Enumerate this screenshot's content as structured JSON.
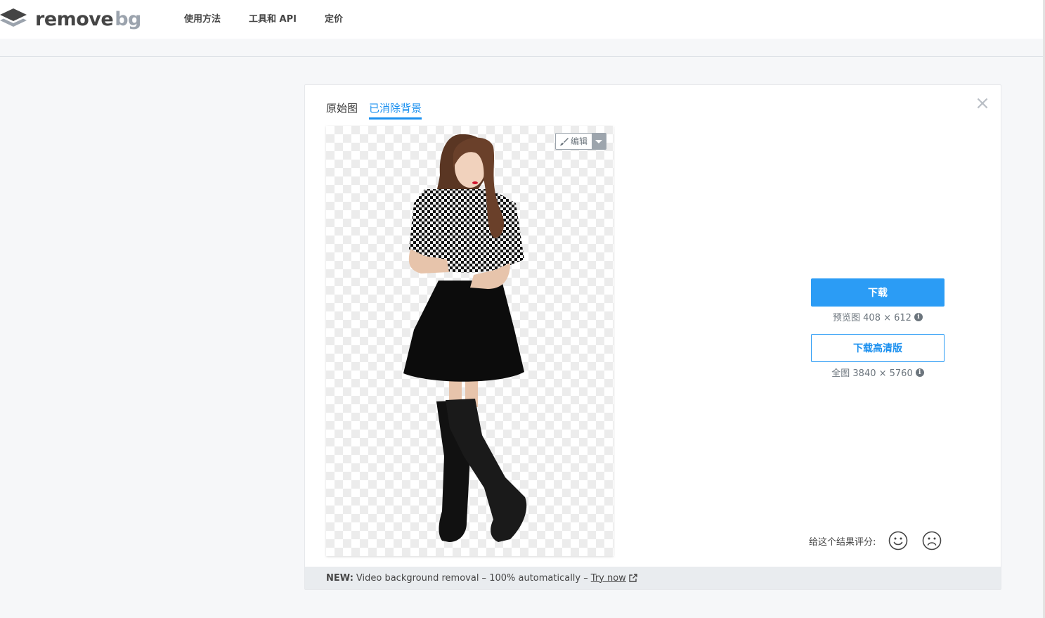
{
  "header": {
    "logo_word1": "remove",
    "logo_word2": "bg",
    "nav": [
      "使用方法",
      "工具和 API",
      "定价"
    ]
  },
  "tabs": {
    "original": "原始图",
    "removed": "已消除背景"
  },
  "editor": {
    "edit_label": "编辑"
  },
  "download": {
    "button_label": "下载",
    "preview_label": "预览图 408 × 612",
    "hd_button_label": "下载高清版",
    "hd_label": "全图 3840 × 5760"
  },
  "rating": {
    "label": "给这个结果评分:"
  },
  "footer": {
    "new_label": "NEW:",
    "text": "Video background removal – 100% automatically –",
    "link": "Try now"
  },
  "colors": {
    "accent": "#2b9cf5",
    "active_tab": "#1b90ef",
    "text": "#454545"
  },
  "icons": [
    "logo-layers-icon",
    "close-icon",
    "brush-icon",
    "caret-down-icon",
    "info-icon",
    "smile-icon",
    "frown-icon",
    "external-link-icon"
  ]
}
